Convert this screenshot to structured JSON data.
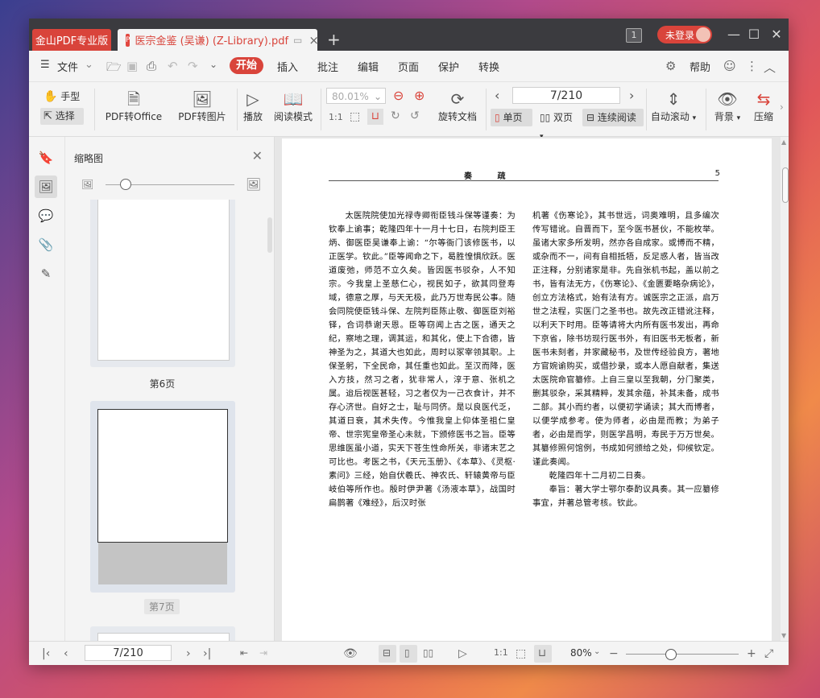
{
  "titlebar": {
    "home_tab": "金山PDF专业版",
    "doc_tab": "医宗金鉴 (吴谦) (Z-Library).pdf",
    "doc_badge": "P",
    "window_count": "1",
    "login": "未登录"
  },
  "menubar": {
    "file": "文件",
    "tabs": [
      "开始",
      "插入",
      "批注",
      "编辑",
      "页面",
      "保护",
      "转换"
    ],
    "help": "帮助"
  },
  "ribbon": {
    "hand": "手型",
    "select": "选择",
    "pdf_to_office": "PDF转Office",
    "pdf_to_image": "PDF转图片",
    "play": "播放",
    "read_mode": "阅读模式",
    "zoom_value": "80.01%",
    "rotate_doc": "旋转文档",
    "page_indicator": "7/210",
    "single_page": "单页",
    "double_page": "双页",
    "continuous": "连续阅读",
    "auto_scroll": "自动滚动",
    "background": "背景",
    "compress": "压缩"
  },
  "thumbnails": {
    "title": "缩略图",
    "pages": [
      {
        "label": "第6页",
        "current": false
      },
      {
        "label": "第7页",
        "current": true
      }
    ]
  },
  "document": {
    "running_title": "奏 疏",
    "page_number": "5",
    "left_column": [
      "太医院院使加光禄寺卿衔臣钱斗保等谨奏：为钦奉上谕事；乾隆四年十一月十七日，右院判臣王炳、御医臣吴谦奉上谕：“尔等衙门该修医书，以正医学。钦此。”臣等闻命之下，曷胜惶惧欣跃。医道废弛，师范不立久矣。皆因医书驳杂，人不知宗。今我皇上圣慈仁心，视民如子，欲其同登寿域，德意之厚，与天无极，此乃万世寿民公事。随会同院使臣钱斗保、左院判臣陈止敬、御医臣刘裕铎，合词恭谢天恩。臣等窃闻上古之医，通天之纪，察地之理，调其运，和其化，使上下合德，皆神圣为之，其道大也如此，周时以冢宰领其职。上保圣躬，下全民命，其任重也如此。至汉而降，医入方技，然习之者，犹非常人，淳于意、张机之属。迨后视医甚轻，习之者仅为一己衣食计，并不存心济世。自好之士，耻与同侪。是以良医代乏，其道日衰，其术失传。今惟我皇上仰体圣祖仁皇帝、世宗宪皇帝圣心未就，下颁修医书之旨。臣等思维医虽小道，实天下苍生性命所关，非诸末艺之可比也。考医之书，《天元玉册》、《本草》、《灵枢·素问》三经，始自伏羲氏、神农氏、轩辕黄帝与臣岐伯等所作也。殷时伊尹著《汤液本草》，战国时扁鹊著《难经》，后汉时张"
    ],
    "right_column": [
      "机著《伤寒论》，其书世远，词奥难明，且多编次传写错讹。自晋而下，至今医书甚伙，不能枚举。虽诸大家多所发明，然亦各自成家。或博而不精，或杂而不一，间有自相抵牾，反足惑人者，皆当改正注释，分别诸家是非。先自张机书起，盖以前之书，皆有法无方，《伤寒论》、《金匮要略杂病论》，创立方法格式，始有法有方。诚医宗之正派，启万世之法程，实医门之圣书也。故先改正错讹注释，以利天下时用。臣等请将大内所有医书发出，再命下京省，除书坊现行医书外，有旧医书无板者，新医书未刻者，并家藏秘书，及世传经验良方，著地方官婉谕购买，或借抄录，或本人愿自献者，集送太医院命官纂修。上自三皇以至我朝，分门聚类，删其驳杂，采其精粹，发其余蕴，补其未备，成书二部。其小而约者，以便初学诵读；其大而博者，以便学成参考。使为师者，必由是而教；为弟子者，必由是而学，则医学昌明，寿民于万万世矣。其纂修照何馆例，书成如何颁给之处，仰候钦定。谨此奏闻。",
      "乾隆四年十二月初二日奏。",
      "奉旨：著大学士鄂尔泰酌议具奏。其一应纂修事宜，并著总管考核。钦此。"
    ]
  },
  "statusbar": {
    "page_indicator": "7/210",
    "zoom": "80%"
  }
}
